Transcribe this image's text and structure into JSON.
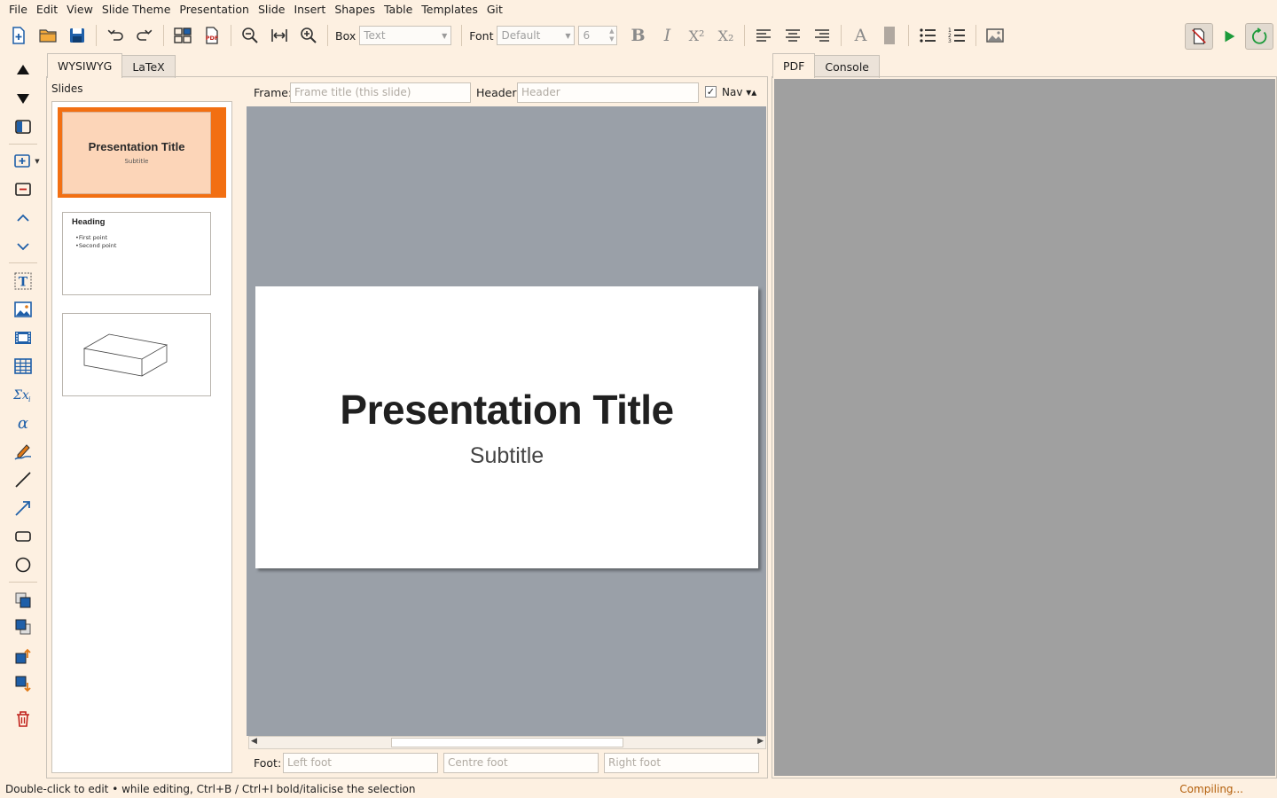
{
  "menu": [
    "File",
    "Edit",
    "View",
    "Slide Theme",
    "Presentation",
    "Slide",
    "Insert",
    "Shapes",
    "Table",
    "Templates",
    "Git"
  ],
  "toolbar": {
    "box_label": "Box",
    "box_value": "Text",
    "font_label": "Font",
    "font_value": "Default",
    "size_value": "6",
    "bold": "B",
    "italic": "I",
    "superscript": "X²",
    "subscript": "X₂",
    "text_color_letter": "A"
  },
  "left_tabs": [
    "WYSIWYG",
    "LaTeX"
  ],
  "right_tabs": [
    "PDF",
    "Console"
  ],
  "slides_panel": {
    "label": "Slides",
    "thumbs": [
      {
        "title": "Presentation Title",
        "subtitle": "Subtitle"
      },
      {
        "heading": "Heading",
        "bullets": [
          "•First point",
          "•Second point"
        ]
      },
      {
        "shape": "3d-box"
      }
    ]
  },
  "frame": {
    "frame_label": "Frame:",
    "frame_placeholder": "Frame title (this slide)",
    "header_label": "Header:",
    "header_placeholder": "Header",
    "nav_checked": true,
    "nav_label": "Nav ▾▴"
  },
  "slide": {
    "title": "Presentation Title",
    "subtitle": "Subtitle"
  },
  "footer": {
    "label": "Foot:",
    "left_placeholder": "Left foot",
    "centre_placeholder": "Centre foot",
    "right_placeholder": "Right foot"
  },
  "status": {
    "hint": "Double-click to edit • while editing, Ctrl+B / Ctrl+I bold/italicise the selection",
    "compile": "Compiling..."
  },
  "colors": {
    "accent_orange": "#f26f12",
    "background": "#fdf0e1",
    "canvas": "#9aa0a8",
    "pdf_bg": "#a0a0a0"
  }
}
